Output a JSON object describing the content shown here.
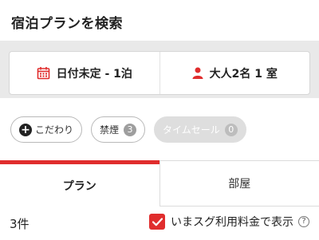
{
  "header": {
    "title": "宿泊プランを検索"
  },
  "search": {
    "date_label": "日付未定 - 1泊",
    "guests_label": "大人2名 1 室"
  },
  "filters": {
    "kodawari_label": "こだわり",
    "nonsmoking_label": "禁煙",
    "nonsmoking_count": "3",
    "timesale_label": "タイムセール",
    "timesale_count": "0"
  },
  "tabs": [
    {
      "label": "プラン",
      "active": true
    },
    {
      "label": "部屋",
      "active": false
    }
  ],
  "results": {
    "count_label": "3件",
    "toggle_label": "いまスグ利用料金で表示",
    "toggle_checked": true,
    "help_glyph": "?"
  },
  "colors": {
    "accent": "#e02d2d",
    "chip_disabled": "#dedede"
  },
  "icons": {
    "date": "calendar-icon",
    "guests": "person-icon",
    "add": "plus-icon",
    "check": "check-icon",
    "help": "question-icon"
  }
}
